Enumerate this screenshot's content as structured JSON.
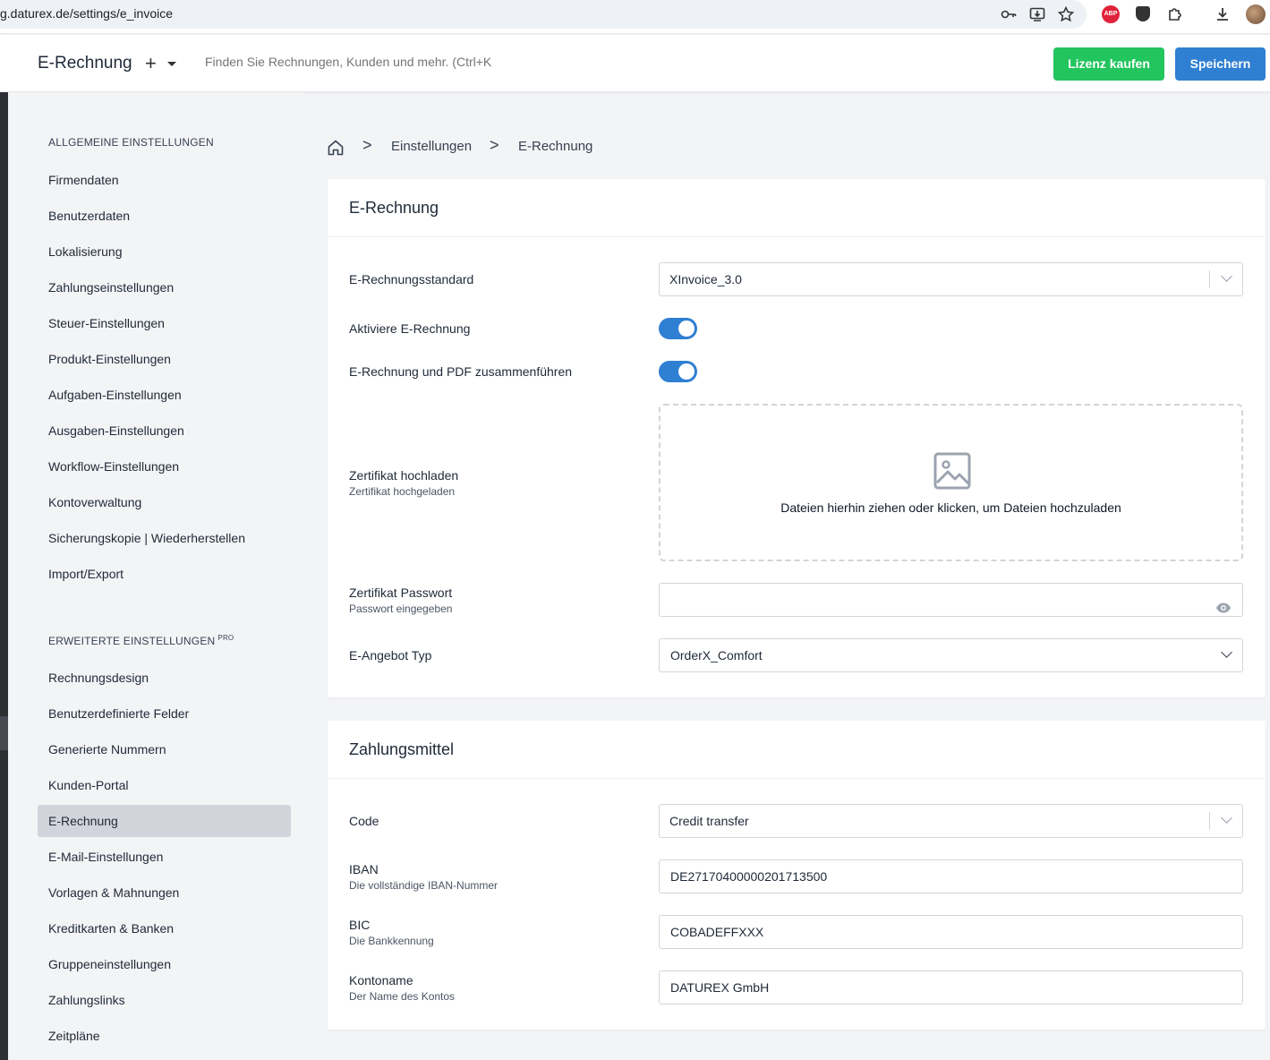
{
  "browser": {
    "url": "g.daturex.de/settings/e_invoice",
    "extension_icons": [
      "key-icon",
      "install-icon",
      "star-icon",
      "adblock-icon",
      "shield-icon",
      "extensions-icon",
      "download-icon",
      "profile-icon"
    ],
    "abp_label": "ABP"
  },
  "header": {
    "title": "E-Rechnung",
    "plus_label": "+",
    "search_placeholder": "Finden Sie Rechnungen, Kunden und mehr. (Ctrl+K)",
    "buy_license_label": "Lizenz kaufen",
    "save_label": "Speichern"
  },
  "sidebar": {
    "general_heading": "ALLGEMEINE EINSTELLUNGEN",
    "general_items": [
      "Firmendaten",
      "Benutzerdaten",
      "Lokalisierung",
      "Zahlungseinstellungen",
      "Steuer-Einstellungen",
      "Produkt-Einstellungen",
      "Aufgaben-Einstellungen",
      "Ausgaben-Einstellungen",
      "Workflow-Einstellungen",
      "Kontoverwaltung",
      "Sicherungskopie | Wiederherstellen",
      "Import/Export"
    ],
    "advanced_heading": "ERWEITERTE EINSTELLUNGEN",
    "advanced_badge": "PRO",
    "advanced_items": [
      "Rechnungsdesign",
      "Benutzerdefinierte Felder",
      "Generierte Nummern",
      "Kunden-Portal",
      "E-Rechnung",
      "E-Mail-Einstellungen",
      "Vorlagen & Mahnungen",
      "Kreditkarten & Banken",
      "Gruppeneinstellungen",
      "Zahlungslinks",
      "Zeitpläne"
    ],
    "active_item": "E-Rechnung"
  },
  "breadcrumb": {
    "items": [
      "Einstellungen",
      "E-Rechnung"
    ],
    "separator": ">"
  },
  "einvoice_card": {
    "title": "E-Rechnung",
    "standard_label": "E-Rechnungsstandard",
    "standard_value": "XInvoice_3.0",
    "activate_label": "Aktiviere E-Rechnung",
    "activate_on": true,
    "merge_label": "E-Rechnung und PDF zusammenführen",
    "merge_on": true,
    "cert_label": "Zertifikat hochladen",
    "cert_sub": "Zertifikat hochgeladen",
    "dropzone_text": "Dateien hierhin ziehen oder klicken, um Dateien hochzuladen",
    "password_label": "Zertifikat Passwort",
    "password_sub": "Passwort eingegeben",
    "password_value": "",
    "offer_type_label": "E-Angebot Typ",
    "offer_type_value": "OrderX_Comfort"
  },
  "payment_card": {
    "title": "Zahlungsmittel",
    "code_label": "Code",
    "code_value": "Credit transfer",
    "iban_label": "IBAN",
    "iban_sub": "Die vollständige IBAN-Nummer",
    "iban_value": "DE27170400000201713500",
    "bic_label": "BIC",
    "bic_sub": "Die Bankkennung",
    "bic_value": "COBADEFFXXX",
    "account_label": "Kontoname",
    "account_sub": "Der Name des Kontos",
    "account_value": "DATUREX GmbH"
  },
  "colors": {
    "primary": "#2f7fd2",
    "success": "#22c55e",
    "sidebar_active": "#d1d5db",
    "background": "#f3f4f6"
  }
}
